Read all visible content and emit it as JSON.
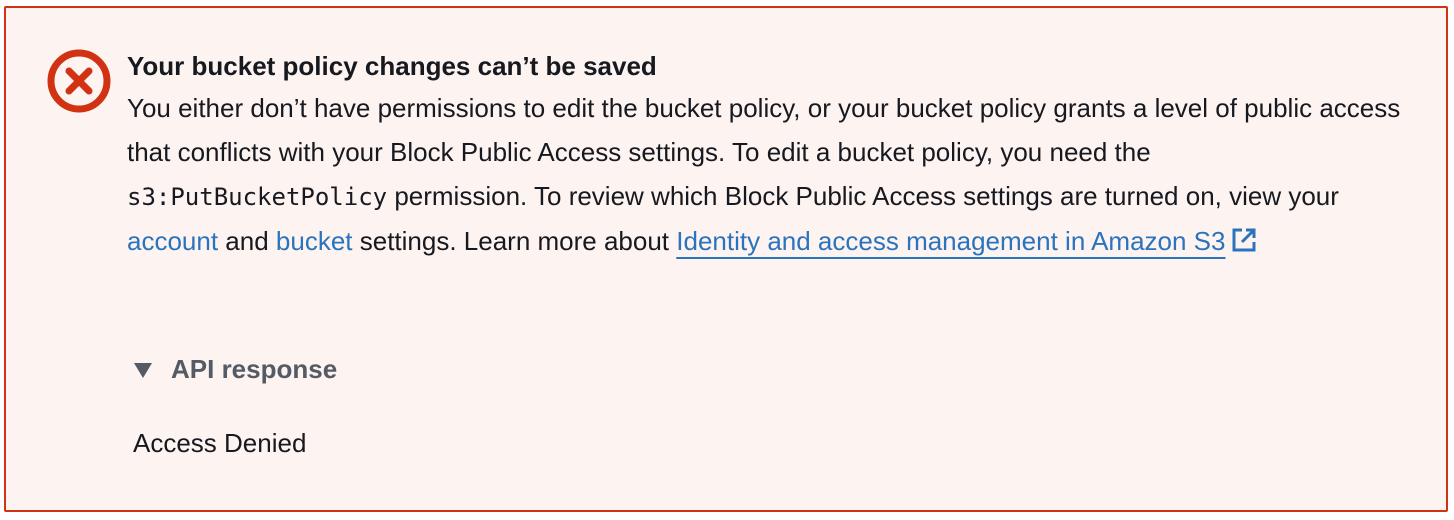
{
  "alert": {
    "type": "error",
    "accent_color": "#d13212",
    "background_color": "#fdf3f1",
    "icon": "error-circle-x-icon",
    "title": "Your bucket policy changes can’t be saved",
    "body": {
      "text_1": "You either don’t have permissions to edit the bucket policy, or your bucket policy grants a level of public access that conflicts with your Block Public Access settings. To edit a bucket policy, you need the ",
      "code_permission": "s3:PutBucketPolicy",
      "text_2": " permission. To review which Block Public Access settings are turned on, view your ",
      "link_account": "account",
      "text_3": " and ",
      "link_bucket": "bucket",
      "text_4": " settings. Learn more about ",
      "link_learn_more": "Identity and access management in Amazon S3",
      "external_icon": "external-link-icon"
    },
    "link_color": "#2a73bd"
  },
  "expander": {
    "label": "API response",
    "expanded": true,
    "icon": "caret-down-icon"
  },
  "api_response": {
    "text": "Access Denied"
  }
}
